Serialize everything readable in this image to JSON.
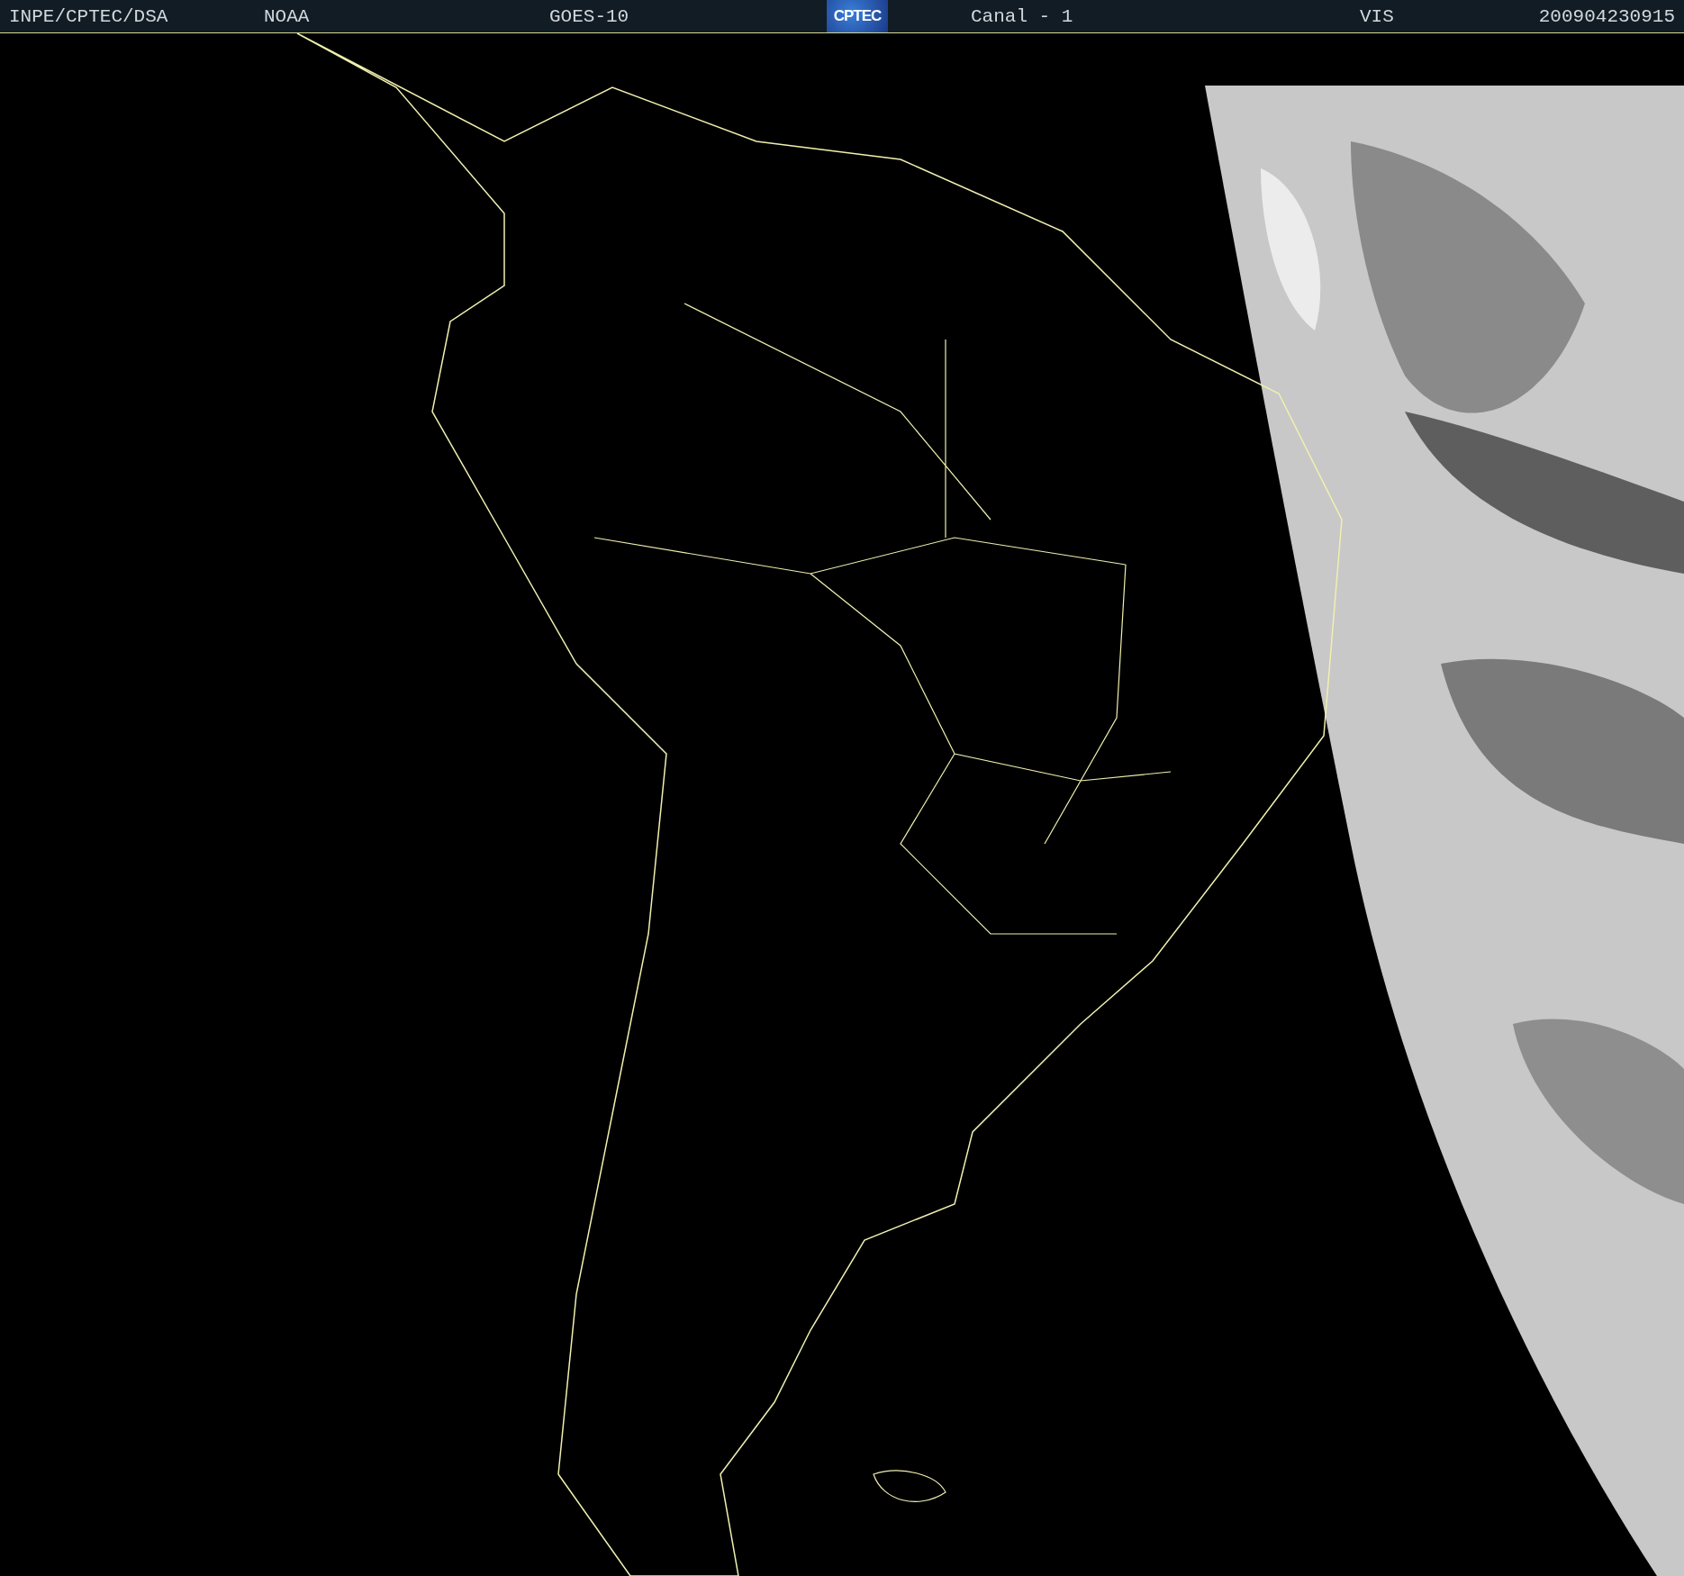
{
  "header": {
    "items": [
      {
        "kind": "text",
        "text": "INPE/CPTEC/DSA"
      },
      {
        "kind": "text",
        "text": "NOAA"
      },
      {
        "kind": "text",
        "text": "GOES-10"
      },
      {
        "kind": "logo",
        "text": "CPTEC"
      },
      {
        "kind": "text",
        "text": "Canal - 1"
      },
      {
        "kind": "text",
        "text": "VIS"
      },
      {
        "kind": "text",
        "text": "200904230915"
      }
    ]
  }
}
